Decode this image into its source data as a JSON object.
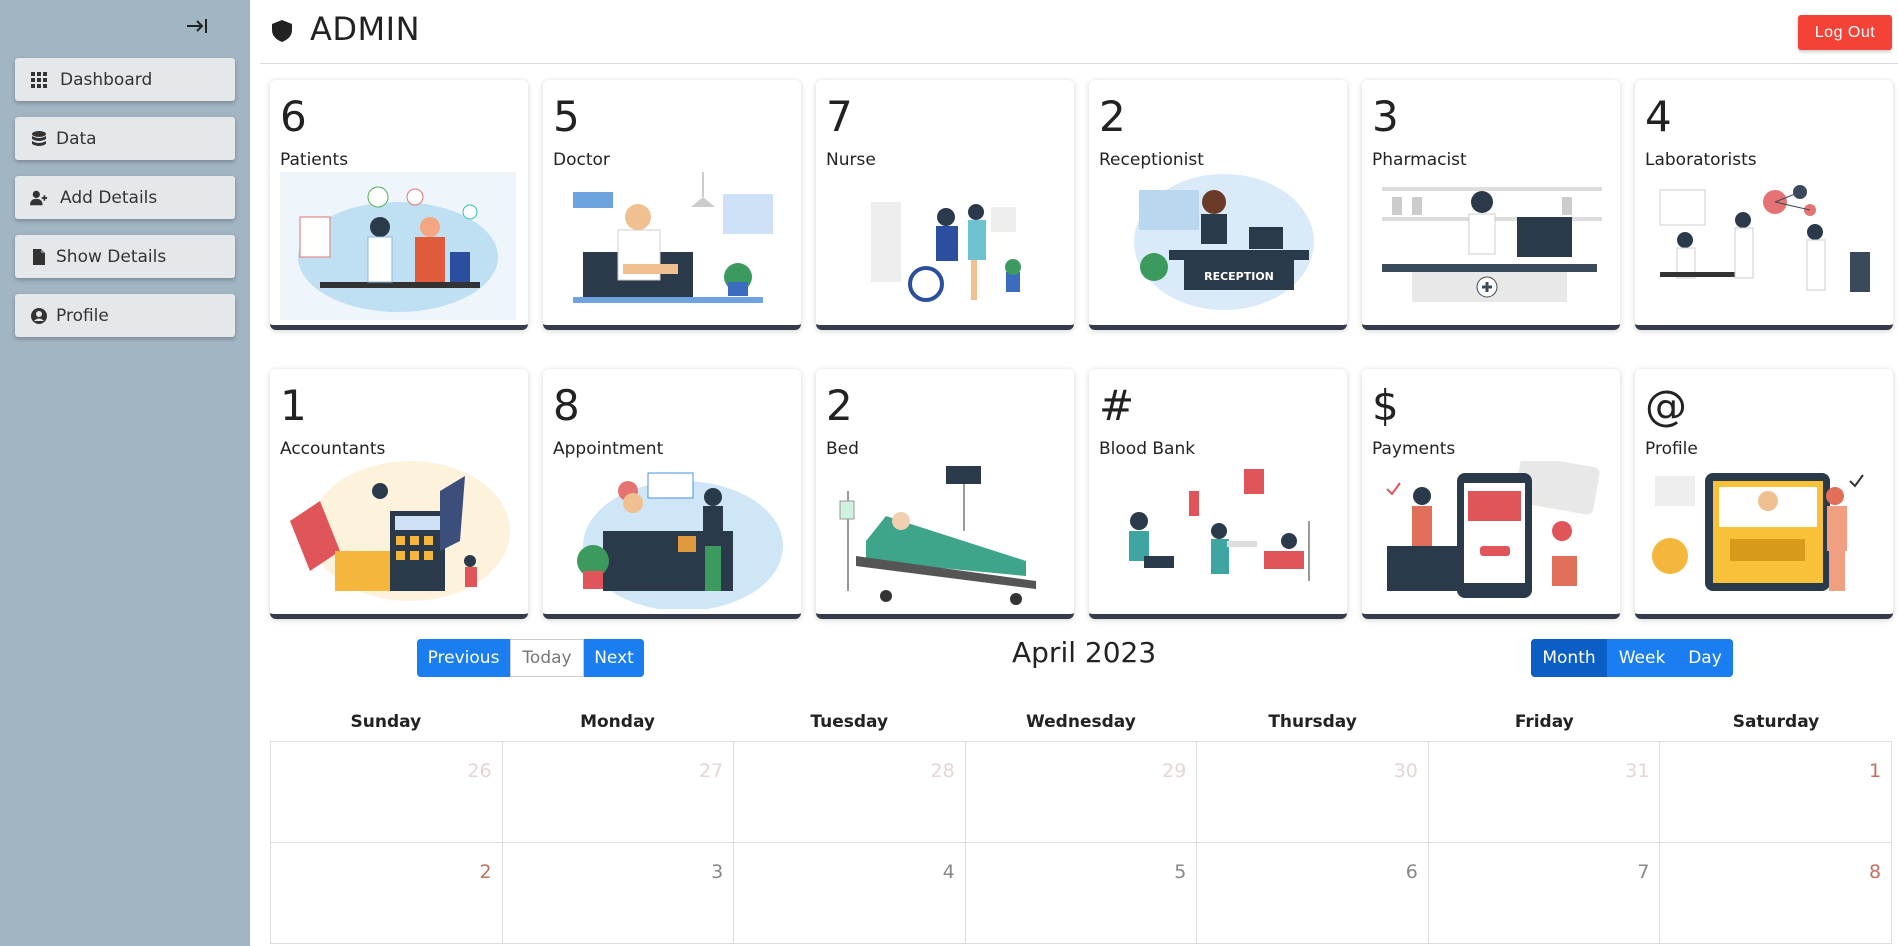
{
  "sidebar": {
    "items": [
      {
        "label": "Dashboard",
        "icon": "grid-icon"
      },
      {
        "label": "Data",
        "icon": "database-icon"
      },
      {
        "label": "Add Details",
        "icon": "user-plus-icon"
      },
      {
        "label": "Show Details",
        "icon": "file-icon"
      },
      {
        "label": "Profile",
        "icon": "user-circle-icon"
      }
    ]
  },
  "header": {
    "title": "ADMIN",
    "logout_label": "Log Out"
  },
  "cards": [
    {
      "count": "6",
      "label": "Patients"
    },
    {
      "count": "5",
      "label": "Doctor"
    },
    {
      "count": "7",
      "label": "Nurse"
    },
    {
      "count": "2",
      "label": "Receptionist"
    },
    {
      "count": "3",
      "label": "Pharmacist"
    },
    {
      "count": "4",
      "label": "Laboratorists"
    },
    {
      "count": "1",
      "label": "Accountants"
    },
    {
      "count": "8",
      "label": "Appointment"
    },
    {
      "count": "2",
      "label": "Bed"
    },
    {
      "count": "#",
      "label": "Blood Bank"
    },
    {
      "count": "$",
      "label": "Payments"
    },
    {
      "count": "@",
      "label": "Profile"
    }
  ],
  "reception_sign": "RECEPTION",
  "calendar": {
    "title": "April 2023",
    "nav": {
      "previous": "Previous",
      "today": "Today",
      "next": "Next"
    },
    "views": {
      "month": "Month",
      "week": "Week",
      "day": "Day"
    },
    "weekdays": [
      "Sunday",
      "Monday",
      "Tuesday",
      "Wednesday",
      "Thursday",
      "Friday",
      "Saturday"
    ],
    "weeks": [
      [
        "26",
        "27",
        "28",
        "29",
        "30",
        "31",
        "1"
      ],
      [
        "2",
        "3",
        "4",
        "5",
        "6",
        "7",
        "8"
      ]
    ]
  },
  "colors": {
    "sidebar": "#a2b5c3",
    "logout": "#f44336",
    "primary": "#1a7df0",
    "card_border": "#353b4b"
  }
}
